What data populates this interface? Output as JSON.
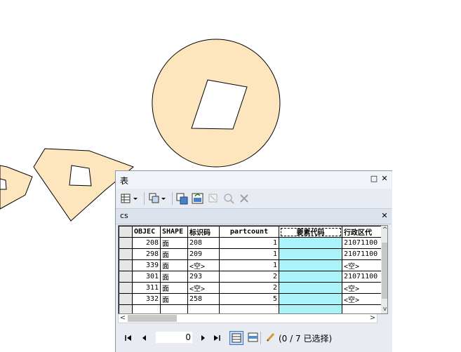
{
  "window": {
    "title": "表",
    "restore_glyph": "□",
    "close_glyph": "✕"
  },
  "tab": {
    "name": "cs",
    "close_glyph": "✕"
  },
  "table": {
    "columns": [
      "OBJEC",
      "SHAPE",
      "标识码",
      "partcount",
      "要素代码",
      "行政区代"
    ],
    "rows": [
      [
        "208",
        "面",
        "208",
        "1",
        "",
        "21071100"
      ],
      [
        "298",
        "面",
        "209",
        "1",
        "",
        "21071100"
      ],
      [
        "339",
        "面",
        "<空>",
        "1",
        "",
        "<空>"
      ],
      [
        "301",
        "面",
        "293",
        "2",
        "",
        "21071100"
      ],
      [
        "311",
        "面",
        "<空>",
        "2",
        "",
        "<空>"
      ],
      [
        "332",
        "面",
        "258",
        "5",
        "",
        "<空>"
      ]
    ],
    "highlight_column": "要素代码"
  },
  "navigation": {
    "current_record": "0",
    "selection_status": "(0 / 7 已选择)"
  },
  "colors": {
    "polygon_fill": "#fde5bd",
    "highlight_column": "#aaf3f8",
    "window_bg": "#e8ecf2"
  }
}
